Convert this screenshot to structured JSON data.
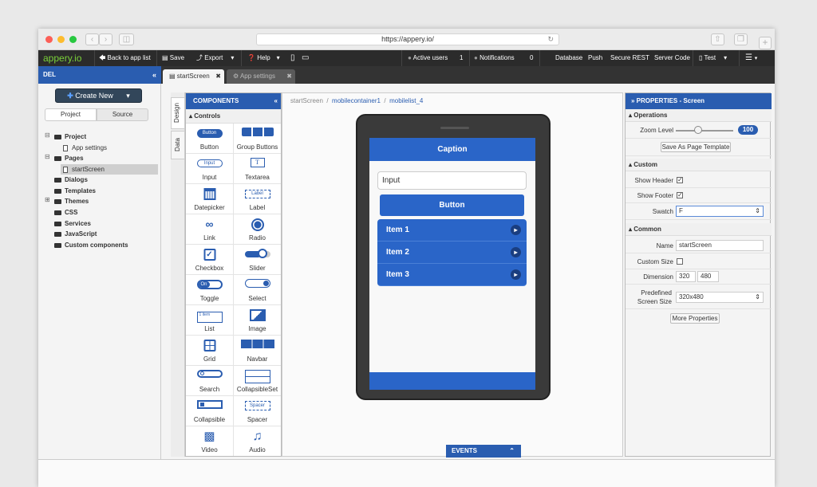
{
  "browser": {
    "url": "https://appery.io/"
  },
  "toolbar": {
    "logo": "appery.io",
    "back": "Back to app list",
    "save": "Save",
    "export": "Export",
    "help": "Help",
    "active_users_label": "Active users",
    "active_users_count": "1",
    "notifications_label": "Notifications",
    "notifications_count": "0",
    "database": "Database",
    "push": "Push",
    "secure_rest": "Secure REST",
    "server_code": "Server Code",
    "test": "Test"
  },
  "tabs": [
    {
      "label": "startScreen"
    },
    {
      "label": "App settings"
    }
  ],
  "left": {
    "header": "DEL",
    "create_new": "Create New",
    "tab_project": "Project",
    "tab_source": "Source",
    "tree": {
      "project": "Project",
      "app_settings": "App settings",
      "pages": "Pages",
      "start_screen": "startScreen",
      "dialogs": "Dialogs",
      "templates": "Templates",
      "themes": "Themes",
      "css": "CSS",
      "services": "Services",
      "javascript": "JavaScript",
      "custom_components": "Custom components"
    }
  },
  "sidetabs": {
    "design": "Design",
    "data": "Data"
  },
  "components": {
    "header": "COMPONENTS",
    "controls": "Controls",
    "items": [
      {
        "label": "Button",
        "preview": "Button"
      },
      {
        "label": "Group Buttons"
      },
      {
        "label": "Input",
        "preview": "Input"
      },
      {
        "label": "Textarea",
        "preview": "T"
      },
      {
        "label": "Datepicker"
      },
      {
        "label": "Label",
        "preview": "Label"
      },
      {
        "label": "Link"
      },
      {
        "label": "Radio"
      },
      {
        "label": "Checkbox"
      },
      {
        "label": "Slider"
      },
      {
        "label": "Toggle",
        "preview": "On"
      },
      {
        "label": "Select"
      },
      {
        "label": "List",
        "preview": "1 item"
      },
      {
        "label": "Image"
      },
      {
        "label": "Grid"
      },
      {
        "label": "Navbar"
      },
      {
        "label": "Search"
      },
      {
        "label": "CollapsibleSet"
      },
      {
        "label": "Collapsible"
      },
      {
        "label": "Spacer",
        "preview": "Spacer"
      },
      {
        "label": "Video"
      },
      {
        "label": "Audio"
      }
    ]
  },
  "breadcrumb": {
    "root": "startScreen",
    "mid": "mobilecontainer1",
    "leaf": "mobilelist_4"
  },
  "phone": {
    "caption": "Caption",
    "input_placeholder": "Input",
    "button": "Button",
    "list": [
      "Item 1",
      "Item 2",
      "Item 3"
    ]
  },
  "events": "EVENTS",
  "properties": {
    "header": "PROPERTIES - Screen",
    "operations": "Operations",
    "zoom_label": "Zoom Level",
    "zoom_value": "100",
    "save_template": "Save As Page Template",
    "custom": "Custom",
    "show_header": "Show Header",
    "show_footer": "Show Footer",
    "swatch_label": "Swatch",
    "swatch_value": "F",
    "common": "Common",
    "name_label": "Name",
    "name_value": "startScreen",
    "custom_size": "Custom Size",
    "dimension_label": "Dimension",
    "dim_w": "320",
    "dim_h": "480",
    "predefined_label_1": "Predefined",
    "predefined_label_2": "Screen Size",
    "predefined_value": "320x480",
    "more": "More Properties"
  },
  "colors": {
    "brand_blue": "#2a5db0",
    "phone_blue": "#2a65c8",
    "toolbar_dark": "#2b2b2b"
  }
}
